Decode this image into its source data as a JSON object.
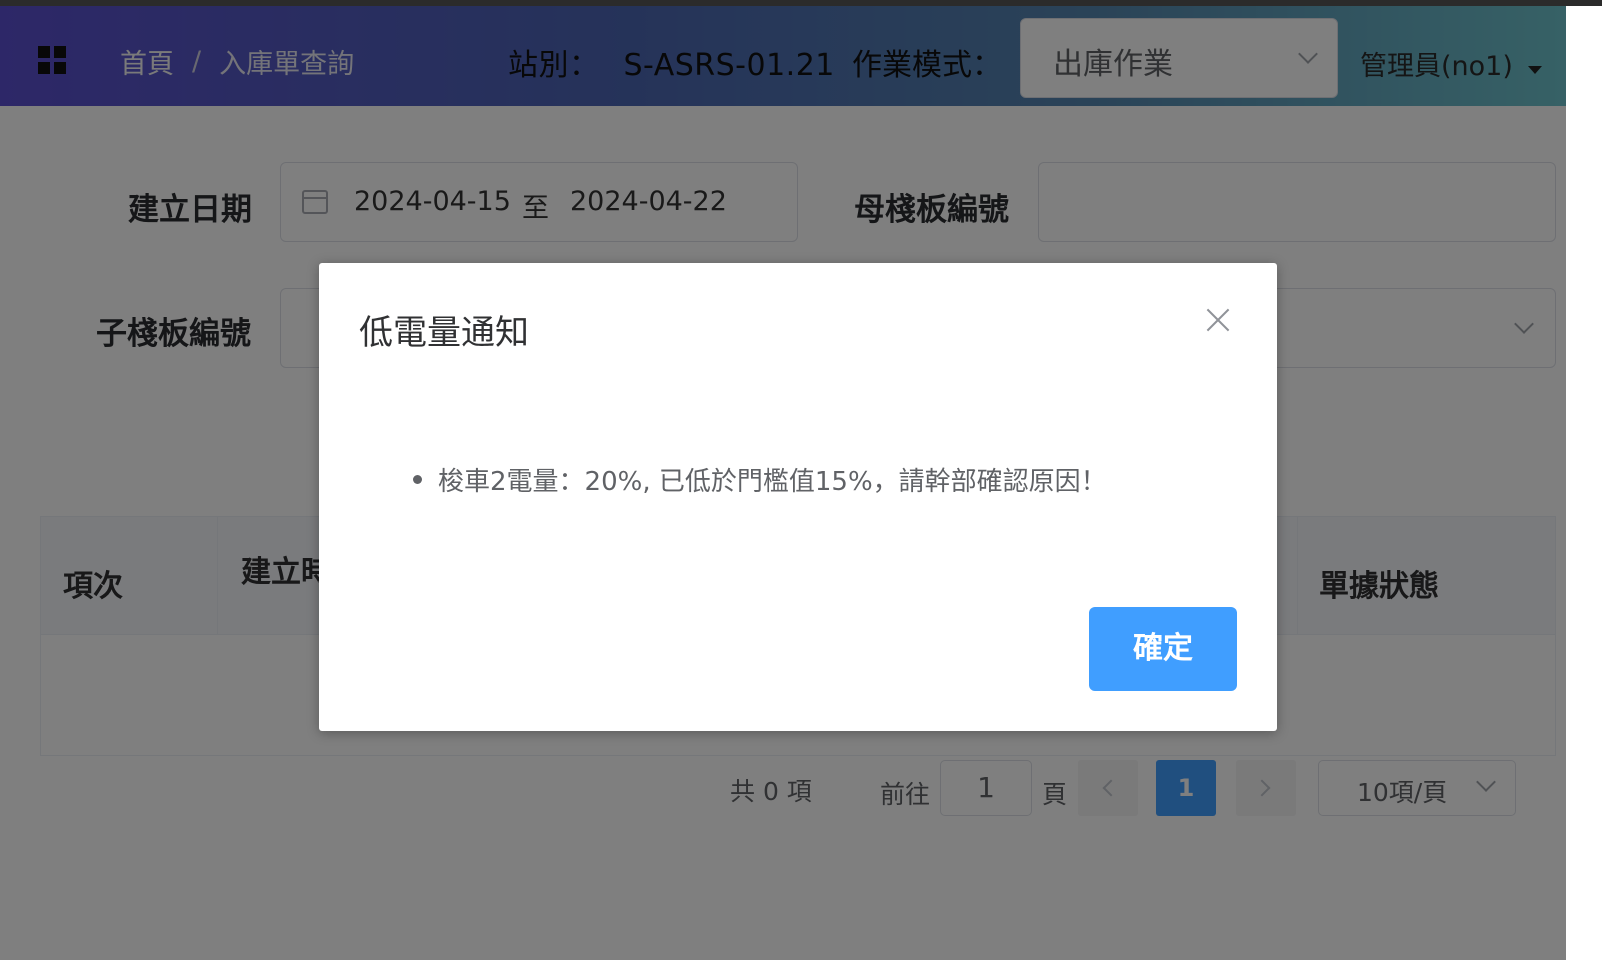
{
  "header": {
    "breadcrumb_home": "首頁",
    "breadcrumb_sep": "/",
    "breadcrumb_current": "入庫單查詢",
    "station_label": "站別：",
    "station_value": "S-ASRS-01.21",
    "mode_label": "作業模式：",
    "mode_value": "出庫作業",
    "user": "管理員(no1)"
  },
  "form": {
    "date_label": "建立日期",
    "date_start": "2024-04-15",
    "date_to": "至",
    "date_end": "2024-04-22",
    "parent_pallet_label": "母棧板編號",
    "parent_pallet_value": "",
    "child_pallet_label": "子棧板編號",
    "child_pallet_value": ""
  },
  "table": {
    "col_index": "項次",
    "col_created": "建立時",
    "col_status": "單據狀態"
  },
  "pagination": {
    "total": "共 0 項",
    "goto": "前往",
    "page_input": "1",
    "page_unit": "頁",
    "current_page": "1",
    "page_size": "10項/頁"
  },
  "dialog": {
    "title": "低電量通知",
    "message": "梭車2電量：20%, 已低於門檻值15%，請幹部確認原因！",
    "confirm": "確定"
  },
  "colors": {
    "primary": "#409eff",
    "header_start": "#5b4fd0",
    "header_end": "#6ec3cc"
  }
}
